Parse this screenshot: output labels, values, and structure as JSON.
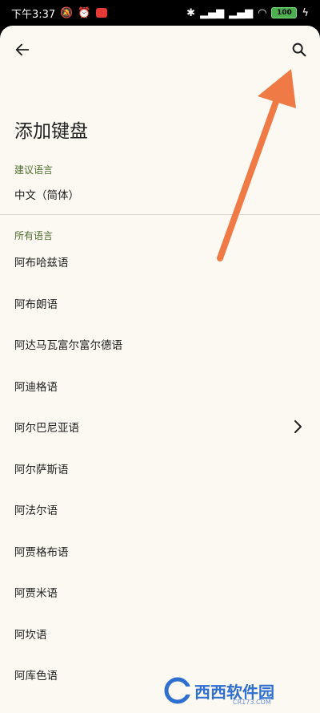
{
  "status_bar": {
    "time": "下午3:37",
    "battery": "100"
  },
  "page": {
    "title": "添加键盘"
  },
  "suggested": {
    "label": "建议语言",
    "items": [
      "中文（简体）"
    ]
  },
  "all": {
    "label": "所有语言",
    "items": [
      "阿布哈兹语",
      "阿布朗语",
      "阿达马瓦富尔富尔德语",
      "阿迪格语",
      "阿尔巴尼亚语",
      "阿尔萨斯语",
      "阿法尔语",
      "阿贾格布语",
      "阿贾米语",
      "阿坎语",
      "阿库色语"
    ]
  },
  "icons": {
    "back": "arrow-left-icon",
    "search": "search-icon",
    "chevron": "chevron-right-icon"
  },
  "colors": {
    "background": "#fbf9f1",
    "section_label": "#4f6b2f",
    "annotation_arrow": "#f07a45"
  },
  "watermark": {
    "logo_text": "西西软件园",
    "sub_text": "CR173.COM"
  }
}
